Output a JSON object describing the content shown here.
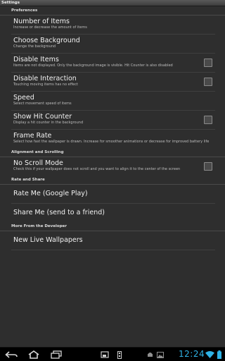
{
  "window": {
    "title": "Settings"
  },
  "sections": {
    "preferences": {
      "header": "Preferences",
      "number_of_items": {
        "title": "Number of Items",
        "summary": "Increase or decrease the amount of items"
      },
      "choose_background": {
        "title": "Choose Background",
        "summary": "Change the background"
      },
      "disable_items": {
        "title": "Disable Items",
        "summary": "Items are not displayed. Only the background image is visible. Hit Counter is also disabled",
        "checked": false
      },
      "disable_interaction": {
        "title": "Disable Interaction",
        "summary": "Touching moving items has no effect",
        "checked": false
      },
      "speed": {
        "title": "Speed",
        "summary": "Select movement speed of items"
      },
      "show_hit_counter": {
        "title": "Show Hit Counter",
        "summary": "Display a hit counter in the background",
        "checked": false
      },
      "frame_rate": {
        "title": "Frame Rate",
        "summary": "Select how fast the wallpaper is drawn. Increase for smoother animations or decrease for improved battery life"
      }
    },
    "alignment": {
      "header": "Alignment and Scrolling",
      "no_scroll_mode": {
        "title": "No Scroll Mode",
        "summary": "Check this if your wallpaper does not scroll and you want to align it to the center of the screen",
        "checked": false
      }
    },
    "rate_share": {
      "header": "Rate and Share",
      "rate_me": {
        "title": "Rate Me (Google Play)"
      },
      "share_me": {
        "title": "Share Me (send to a friend)"
      }
    },
    "developer": {
      "header": "More From the Developer",
      "new_live_wallpapers": {
        "title": "New Live Wallpapers"
      }
    }
  },
  "status_bar": {
    "clock": "12:24",
    "icons": [
      "back-icon",
      "home-icon",
      "recent-apps-icon",
      "screenshot-icon",
      "menu-icon",
      "android-notification-icon",
      "image-notification-icon",
      "wifi-icon",
      "battery-icon"
    ]
  },
  "colors": {
    "clock": "#2fb3e6",
    "background": "#2e2e2e"
  }
}
